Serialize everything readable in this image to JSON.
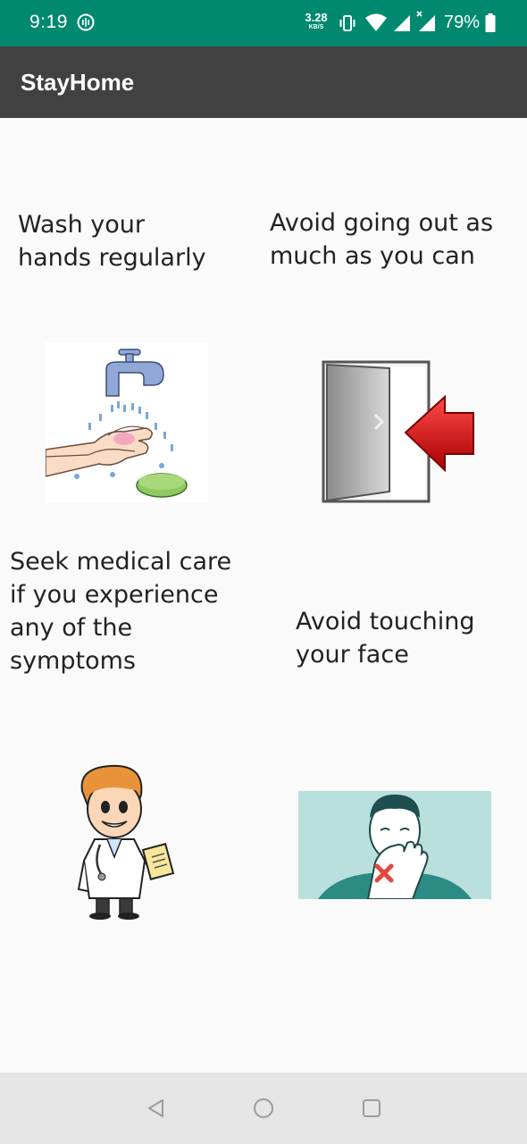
{
  "status_bar": {
    "time": "9:19",
    "net_speed_value": "3.28",
    "net_speed_unit": "KB/S",
    "battery_percent": "79%",
    "icons": [
      "audio-app-icon",
      "vibrate-icon",
      "wifi-icon",
      "signal-icon",
      "signal-x-icon",
      "battery-icon"
    ],
    "background_color": "#00896f"
  },
  "app_bar": {
    "title": "StayHome",
    "background_color": "#414141"
  },
  "tips": [
    {
      "lines": [
        "Wash your",
        "hands regularly"
      ],
      "illustration": "hand-washing-illustration"
    },
    {
      "lines": [
        "Avoid going out as",
        "much as you can"
      ],
      "illustration": "door-exit-illustration"
    },
    {
      "lines": [
        "Seek medical care",
        "if you experience",
        "any of the",
        "symptoms"
      ],
      "illustration": "doctor-illustration"
    },
    {
      "lines": [
        "Avoid touching",
        "your face"
      ],
      "illustration": "face-touch-illustration"
    }
  ],
  "nav_bar": {
    "buttons": [
      "back-icon",
      "home-icon",
      "recents-icon"
    ]
  }
}
